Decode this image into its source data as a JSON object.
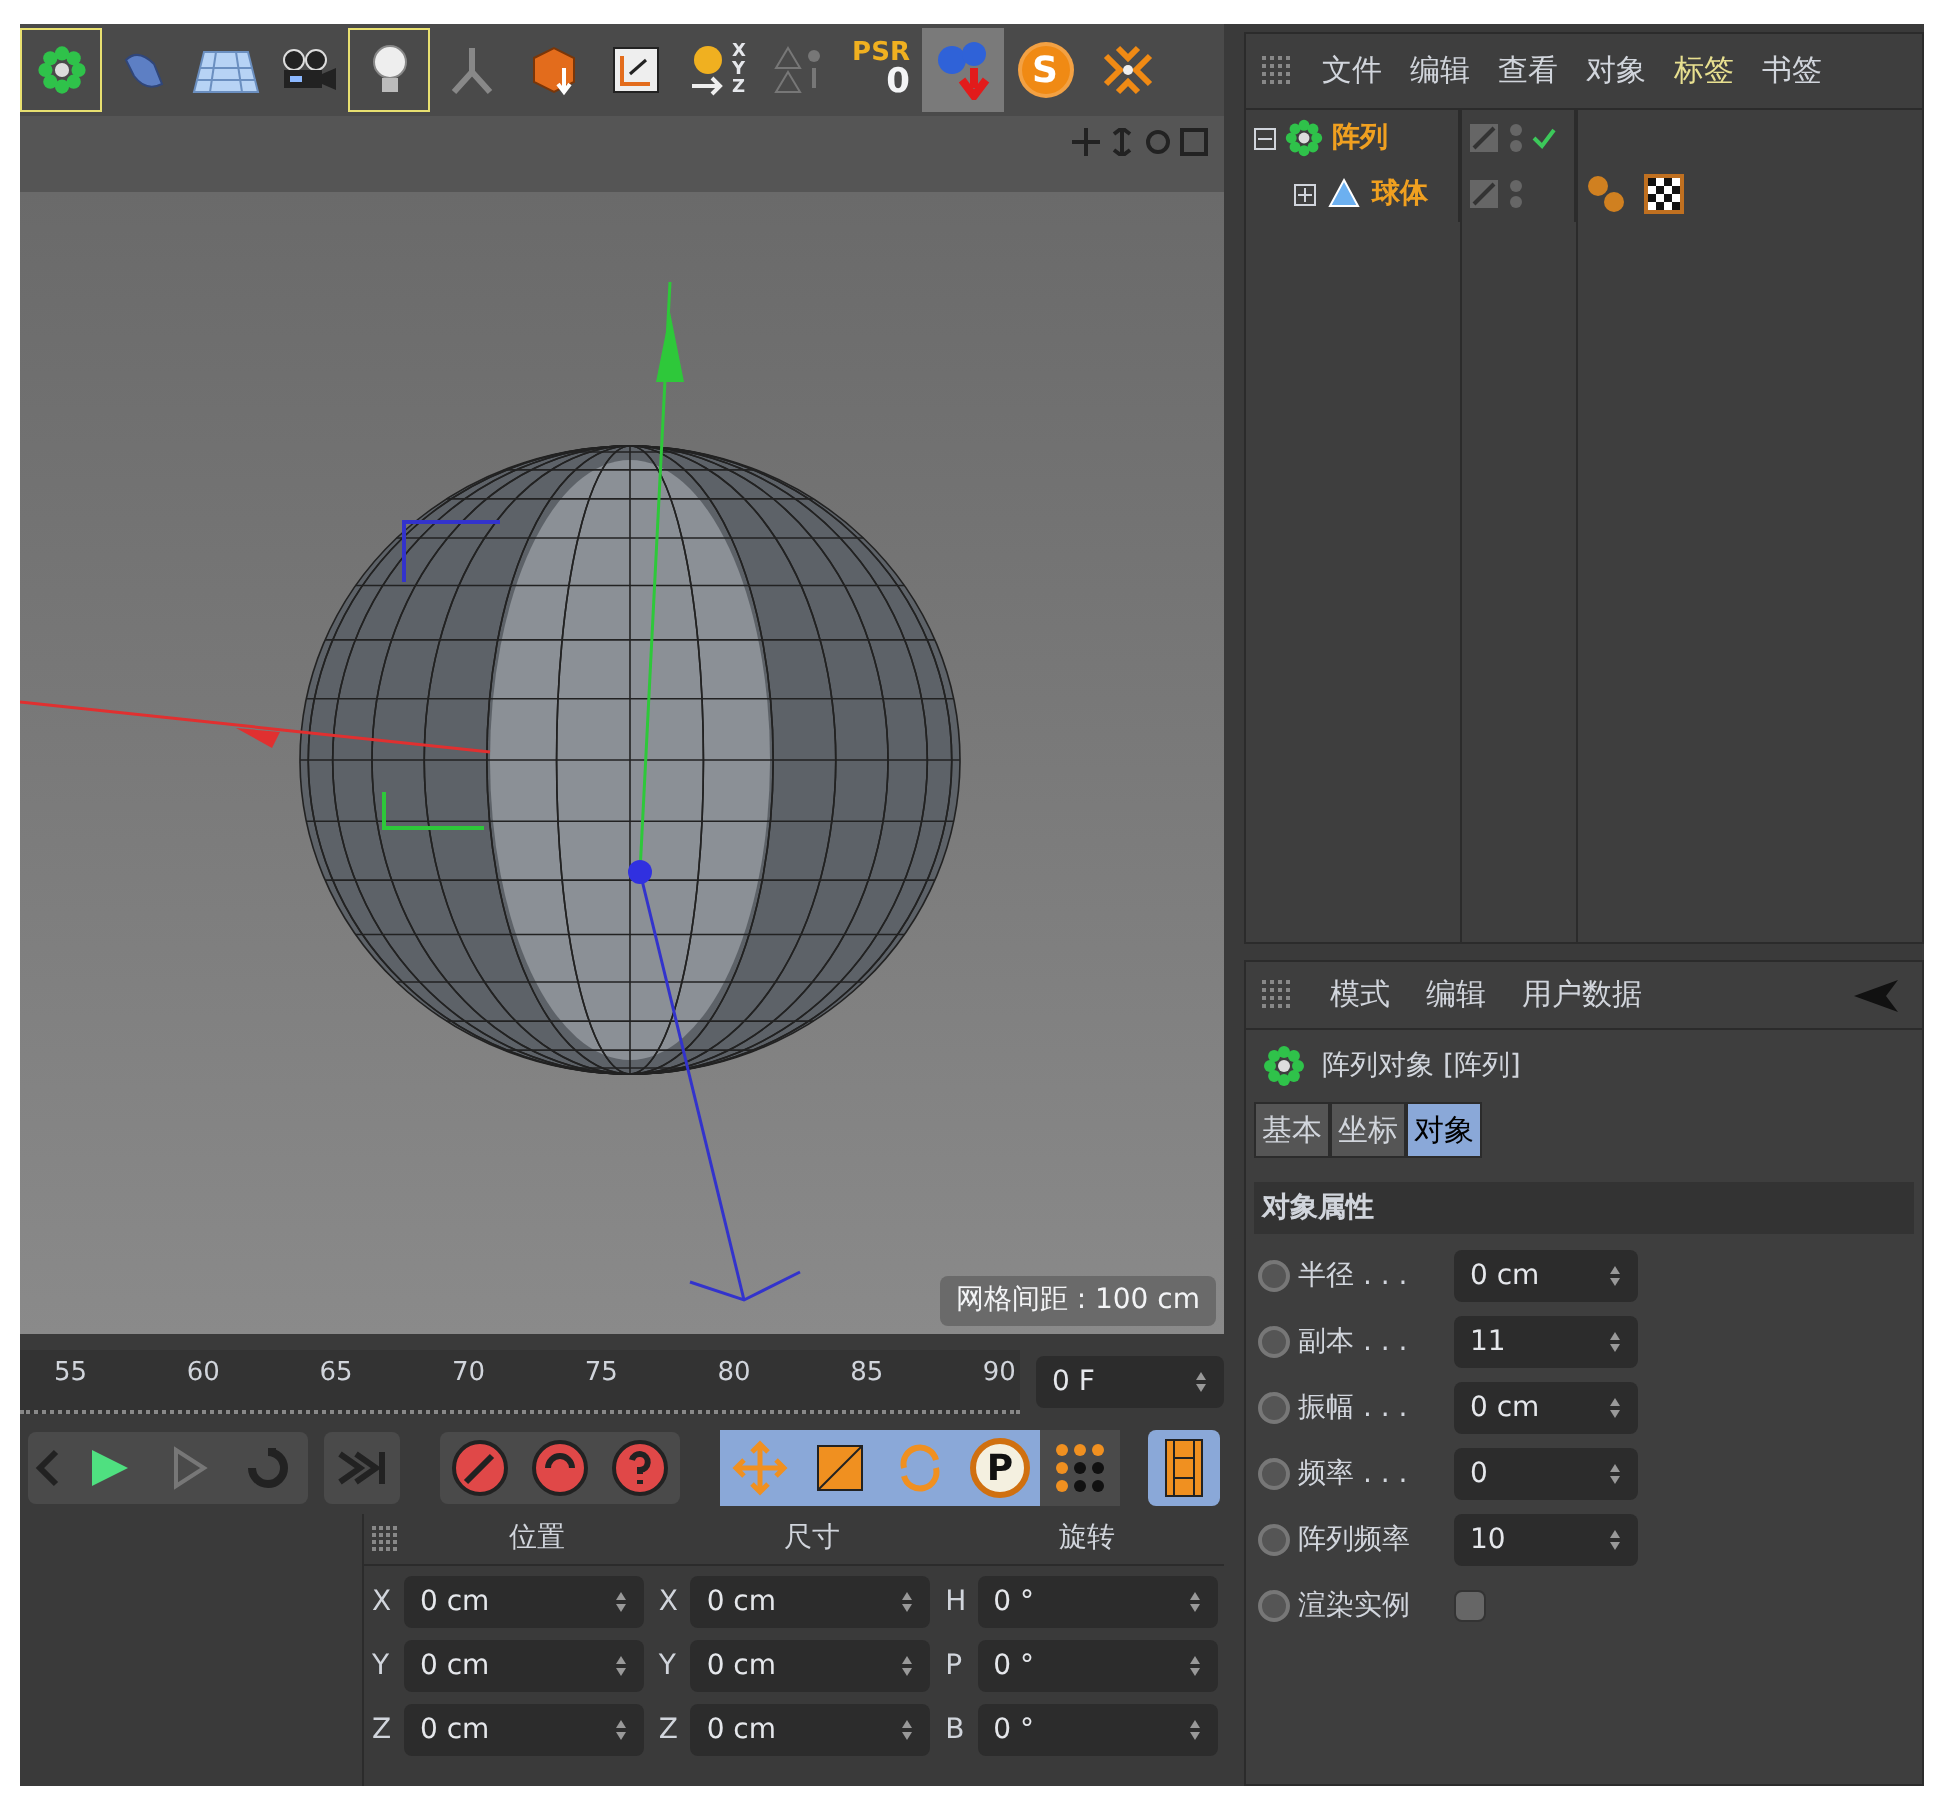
{
  "toolbar": {
    "tools": [
      {
        "kind": "array",
        "selected": true
      },
      {
        "kind": "bend",
        "selected": false
      },
      {
        "kind": "floor",
        "selected": false
      },
      {
        "kind": "camera",
        "selected": false
      },
      {
        "kind": "light",
        "selected": true
      },
      {
        "kind": "joint",
        "selected": false
      },
      {
        "kind": "bake",
        "selected": false
      },
      {
        "kind": "frame",
        "selected": false
      },
      {
        "kind": "coords",
        "selected": false,
        "letters": "XYZ"
      },
      {
        "kind": "snap",
        "selected": false
      },
      {
        "kind": "psr",
        "selected": false,
        "label": "PSR",
        "value": "0"
      },
      {
        "kind": "drop",
        "selected": true
      },
      {
        "kind": "script",
        "selected": false,
        "label": "S"
      },
      {
        "kind": "collapse",
        "selected": false
      }
    ]
  },
  "viewport": {
    "grid_spacing": "网格间距 : 100 cm"
  },
  "object_manager": {
    "menu": [
      {
        "label": "文件",
        "selected": false
      },
      {
        "label": "编辑",
        "selected": false
      },
      {
        "label": "查看",
        "selected": false
      },
      {
        "label": "对象",
        "selected": false
      },
      {
        "label": "标签",
        "selected": true
      },
      {
        "label": "书签",
        "selected": false
      }
    ],
    "objects": [
      {
        "name": "阵列",
        "kind": "array",
        "selected": true,
        "expanded": true,
        "children": [
          {
            "name": "球体",
            "kind": "sphere",
            "selected": true,
            "expanded": false,
            "tags": [
              {
                "kind": "phong"
              },
              {
                "kind": "material"
              }
            ]
          }
        ]
      }
    ]
  },
  "timeline": {
    "ticks": [
      "55",
      "60",
      "65",
      "70",
      "75",
      "80",
      "85",
      "90"
    ],
    "frame": "0 F"
  },
  "transport": {
    "modes": [
      {
        "kind": "move",
        "selected": true
      },
      {
        "kind": "scale",
        "selected": true
      },
      {
        "kind": "rotate",
        "selected": true
      },
      {
        "kind": "p",
        "selected": true,
        "label": "P"
      },
      {
        "kind": "points",
        "selected": false
      }
    ]
  },
  "coordinates": {
    "headers": [
      "位置",
      "尺寸",
      "旋转"
    ],
    "columns": [
      [
        {
          "axis": "X",
          "value": "0 cm"
        },
        {
          "axis": "Y",
          "value": "0 cm"
        },
        {
          "axis": "Z",
          "value": "0 cm"
        }
      ],
      [
        {
          "axis": "X",
          "value": "0 cm"
        },
        {
          "axis": "Y",
          "value": "0 cm"
        },
        {
          "axis": "Z",
          "value": "0 cm"
        }
      ],
      [
        {
          "axis": "H",
          "value": "0 °"
        },
        {
          "axis": "P",
          "value": "0 °"
        },
        {
          "axis": "B",
          "value": "0 °"
        }
      ]
    ]
  },
  "attributes": {
    "menu": [
      "模式",
      "编辑",
      "用户数据"
    ],
    "title": "阵列对象 [阵列]",
    "tabs": [
      {
        "label": "基本",
        "selected": false
      },
      {
        "label": "坐标",
        "selected": false
      },
      {
        "label": "对象",
        "selected": true
      }
    ],
    "section": "对象属性",
    "params": [
      {
        "kind": "number",
        "label": "半径 . . .",
        "value": "0 cm",
        "keyed": false
      },
      {
        "kind": "number",
        "label": "副本 . . .",
        "value": "11",
        "keyed": false
      },
      {
        "kind": "number",
        "label": "振幅 . . .",
        "value": "0 cm",
        "keyed": false
      },
      {
        "kind": "number",
        "label": "频率 . . .",
        "value": "0",
        "keyed": false
      },
      {
        "kind": "number",
        "label": "阵列频率",
        "value": "10",
        "keyed": false
      },
      {
        "kind": "checkbox",
        "label": "渲染实例",
        "checked": false,
        "keyed": false
      }
    ]
  }
}
